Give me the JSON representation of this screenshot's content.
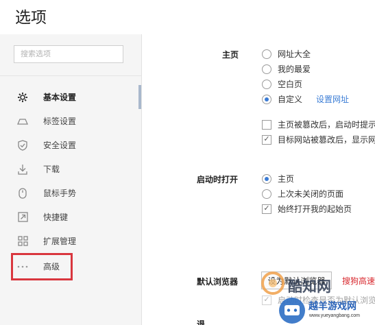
{
  "window": {
    "title": "选项"
  },
  "search": {
    "placeholder": "搜索选项"
  },
  "sidebar": {
    "items": [
      {
        "label": "基本设置",
        "icon": "gear-icon",
        "active": true
      },
      {
        "label": "标签设置",
        "icon": "tab-icon"
      },
      {
        "label": "安全设置",
        "icon": "shield-icon"
      },
      {
        "label": "下载",
        "icon": "download-icon"
      },
      {
        "label": "鼠标手势",
        "icon": "mouse-icon"
      },
      {
        "label": "快捷键",
        "icon": "shortcut-icon"
      },
      {
        "label": "扩展管理",
        "icon": "extensions-icon"
      },
      {
        "label": "高级",
        "icon": "more-icon"
      }
    ]
  },
  "homepage": {
    "label": "主页",
    "options": [
      "网址大全",
      "我的最爱",
      "空白页",
      "自定义"
    ],
    "selected": "自定义",
    "set_url_link": "设置网址",
    "check1": "主页被篡改后，启动时提示",
    "check2": "目标网站被篡改后，显示网页"
  },
  "startup": {
    "label": "启动时打开",
    "options": [
      "主页",
      "上次未关闭的页面"
    ],
    "selected": "主页",
    "check": "始终打开我的起始页"
  },
  "default_browser": {
    "label": "默认浏览器",
    "button": "设为默认浏览器",
    "warning": "搜狗高速浏",
    "check": "启动时检查是否为默认浏览"
  },
  "partial_section": {
    "label": "退"
  },
  "watermark": {
    "main": "酷知网",
    "site": "越羊游戏网",
    "url": "www.yueyangbang.com"
  },
  "colors": {
    "accent": "#3b7bd4",
    "highlight": "#d9363e",
    "warning": "#d8282e",
    "sidebar_bg": "#f5f5f5"
  }
}
